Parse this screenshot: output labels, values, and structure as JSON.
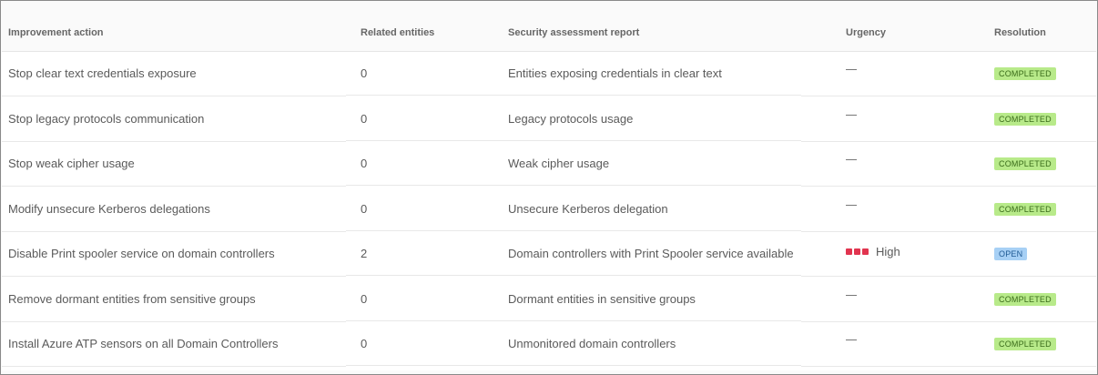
{
  "table": {
    "headers": {
      "action": "Improvement action",
      "related": "Related entities",
      "report": "Security assessment report",
      "urgency": "Urgency",
      "resolution": "Resolution"
    },
    "rows": [
      {
        "action": "Stop clear text credentials exposure",
        "related": "0",
        "report": "Entities exposing credentials in clear text",
        "urgency": "none",
        "resolution": "COMPLETED"
      },
      {
        "action": "Stop legacy protocols communication",
        "related": "0",
        "report": "Legacy protocols usage",
        "urgency": "none",
        "resolution": "COMPLETED"
      },
      {
        "action": "Stop weak cipher usage",
        "related": "0",
        "report": "Weak cipher usage",
        "urgency": "none",
        "resolution": "COMPLETED"
      },
      {
        "action": "Modify unsecure Kerberos delegations",
        "related": "0",
        "report": "Unsecure Kerberos delegation",
        "urgency": "none",
        "resolution": "COMPLETED"
      },
      {
        "action": "Disable Print spooler service on domain controllers",
        "related": "2",
        "report": "Domain controllers with Print Spooler service available",
        "urgency": "High",
        "resolution": "OPEN"
      },
      {
        "action": "Remove dormant entities from sensitive groups",
        "related": "0",
        "report": "Dormant entities in sensitive groups",
        "urgency": "none",
        "resolution": "COMPLETED"
      },
      {
        "action": "Install Azure ATP sensors on all Domain Controllers",
        "related": "0",
        "report": "Unmonitored domain controllers",
        "urgency": "none",
        "resolution": "COMPLETED"
      }
    ]
  },
  "colors": {
    "completed_badge": "#b8ea8a",
    "open_badge": "#a7d0f5",
    "urgency_high": "#e1344f"
  }
}
